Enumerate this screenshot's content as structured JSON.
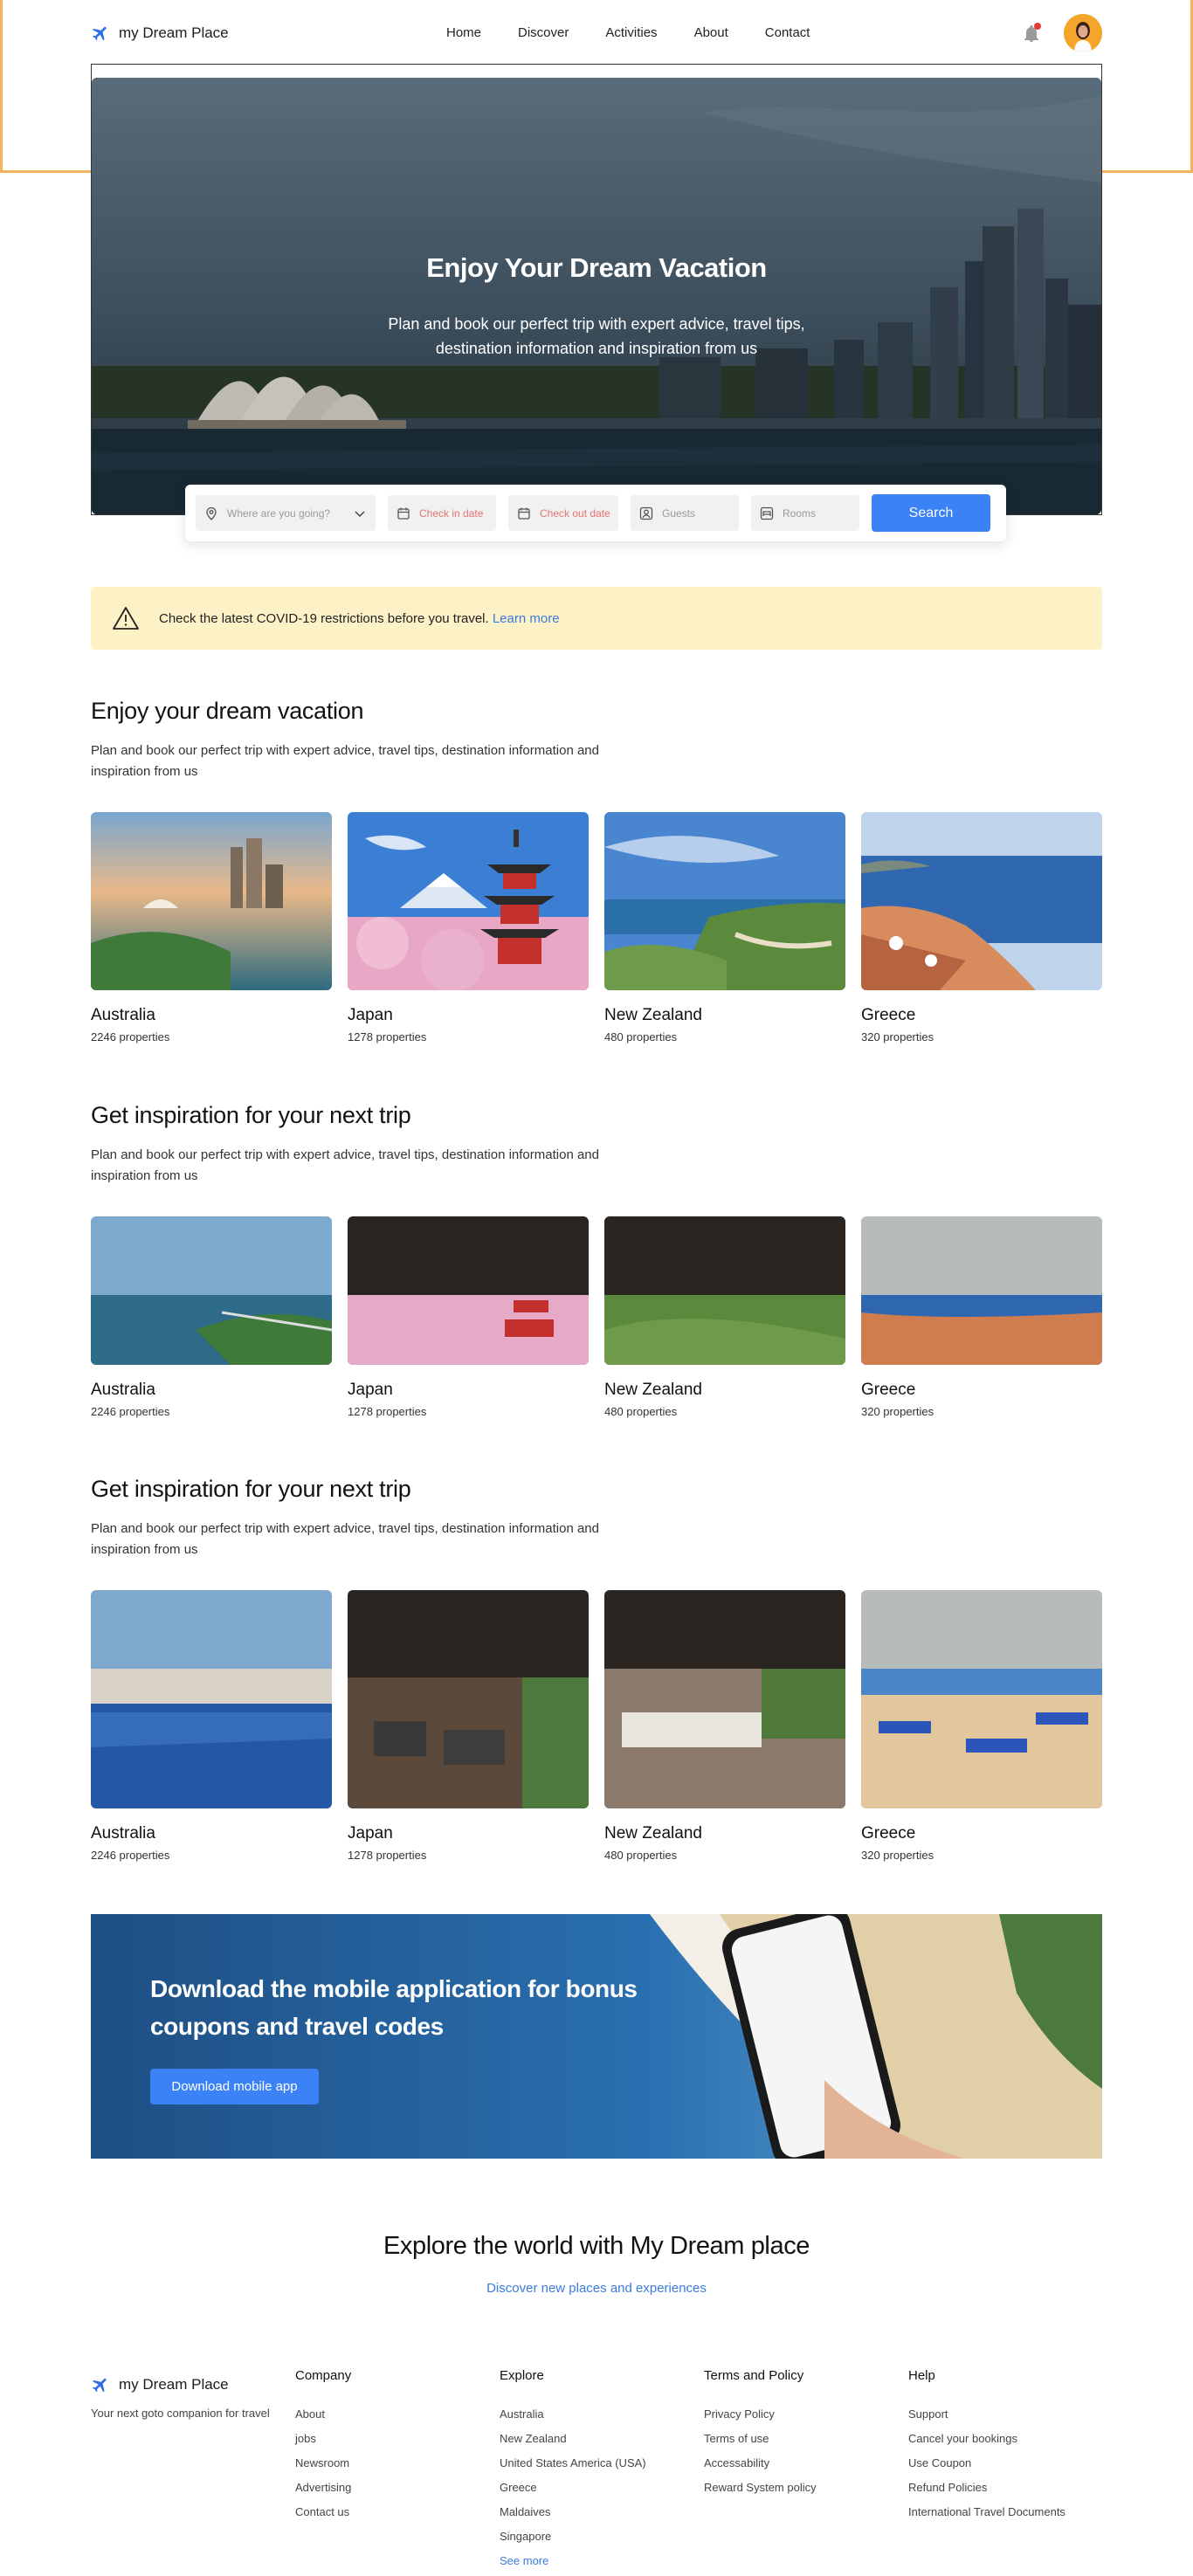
{
  "header": {
    "brand": "my Dream Place",
    "nav": [
      "Home",
      "Discover",
      "Activities",
      "About",
      "Contact"
    ]
  },
  "hero": {
    "title": "Enjoy Your Dream Vacation",
    "subtitle": "Plan and book our perfect trip with expert advice, travel tips, destination information and inspiration from us"
  },
  "search": {
    "destination_placeholder": "Where are you going?",
    "checkin_placeholder": "Check in date",
    "checkout_placeholder": "Check out date",
    "guests_placeholder": "Guests",
    "rooms_placeholder": "Rooms",
    "button": "Search"
  },
  "covid": {
    "text": "Check the latest COVID-19 restrictions before you travel.",
    "link": "Learn more"
  },
  "sections": [
    {
      "title": "Enjoy your dream vacation",
      "description": "Plan and book our perfect trip with expert advice, travel tips, destination information and inspiration from us",
      "cards": [
        {
          "name": "Australia",
          "props": "2246 properties"
        },
        {
          "name": "Japan",
          "props": "1278 properties"
        },
        {
          "name": "New Zealand",
          "props": "480 properties"
        },
        {
          "name": "Greece",
          "props": "320 properties"
        }
      ]
    },
    {
      "title": "Get inspiration for your next trip",
      "description": "Plan and book our perfect trip with expert advice, travel tips, destination information and inspiration from us",
      "cards": [
        {
          "name": "Australia",
          "props": "2246 properties"
        },
        {
          "name": "Japan",
          "props": "1278 properties"
        },
        {
          "name": "New Zealand",
          "props": "480 properties"
        },
        {
          "name": "Greece",
          "props": "320 properties"
        }
      ]
    },
    {
      "title": "Get inspiration for your next trip",
      "description": "Plan and book our perfect trip with expert advice, travel tips, destination information and inspiration from us",
      "cards": [
        {
          "name": "Australia",
          "props": "2246 properties"
        },
        {
          "name": "Japan",
          "props": "1278 properties"
        },
        {
          "name": "New Zealand",
          "props": "480 properties"
        },
        {
          "name": "Greece",
          "props": "320 properties"
        }
      ]
    }
  ],
  "promo": {
    "title": "Download the mobile application for bonus coupons and travel codes",
    "button": "Download mobile app"
  },
  "explore": {
    "title": "Explore the world with My Dream place",
    "link": "Discover new places and experiences"
  },
  "footer": {
    "brand": "my Dream Place",
    "tagline": "Your next goto companion for travel",
    "columns": [
      {
        "title": "Company",
        "links": [
          "About",
          "jobs",
          "Newsroom",
          "Advertising",
          "Contact us"
        ]
      },
      {
        "title": "Explore",
        "links": [
          "Australia",
          "New Zealand",
          "United States America (USA)",
          "Greece",
          "Maldaives",
          "Singapore"
        ],
        "more": "See more"
      },
      {
        "title": "Terms and Policy",
        "links": [
          "Privacy Policy",
          "Terms of use",
          "Accessability",
          "Reward System policy"
        ]
      },
      {
        "title": "Help",
        "links": [
          "Support",
          "Cancel your bookings",
          "Use Coupon",
          "Refund Policies",
          "International Travel Documents"
        ]
      }
    ]
  },
  "colors": {
    "accent": "#3b82f6",
    "link": "#3b7be0",
    "covid_bg": "#fdf1c6",
    "highlight_frame": "#f6b15c"
  }
}
